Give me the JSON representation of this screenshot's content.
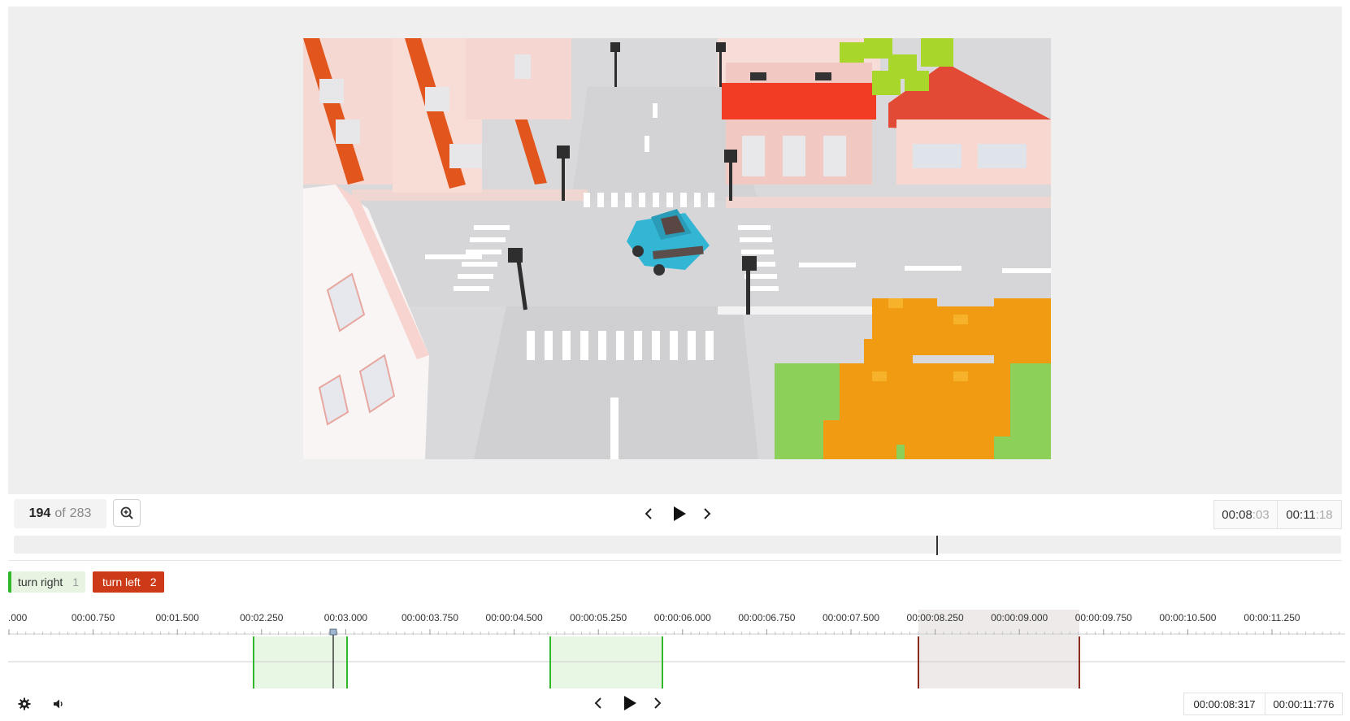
{
  "player": {
    "frame_current": "194",
    "frame_of": "of",
    "frame_total": "283",
    "time_current_main": "00:08",
    "time_current_frac": ":03",
    "time_total_main": "00:11",
    "time_total_frac": ":18",
    "seek_progress": 0.695
  },
  "labels": [
    {
      "name": "turn right",
      "count": "1",
      "color": "#30b72a"
    },
    {
      "name": "turn left",
      "count": "2",
      "color": "#cc3a18"
    }
  ],
  "timeline": {
    "ticks": [
      ".000",
      "00:00.750",
      "00:01.500",
      "00:02.250",
      "00:03.000",
      "00:00:03.750",
      "00:00:04.500",
      "00:00:05.250",
      "00:00:06.000",
      "00:00:06.750",
      "00:00:07.500",
      "00:00:08.250",
      "00:00:09.000",
      "00:00:09.750",
      "00:00:10.500",
      "00:00:11.250"
    ],
    "playhead_time": "00:00:03.000",
    "colors": {
      "green": "#30b72a",
      "red": "#8b2a1a",
      "green_fill": "#e8f6e4",
      "red_fill": "#eeeaea"
    }
  },
  "bottom": {
    "time_current": "00:00:08:317",
    "time_total": "00:00:11:776"
  },
  "icons": {
    "zoom": "zoom-in-icon",
    "prev": "chevron-left-icon",
    "play": "play-icon",
    "next": "chevron-right-icon",
    "settings": "gear-icon",
    "volume": "volume-icon"
  }
}
